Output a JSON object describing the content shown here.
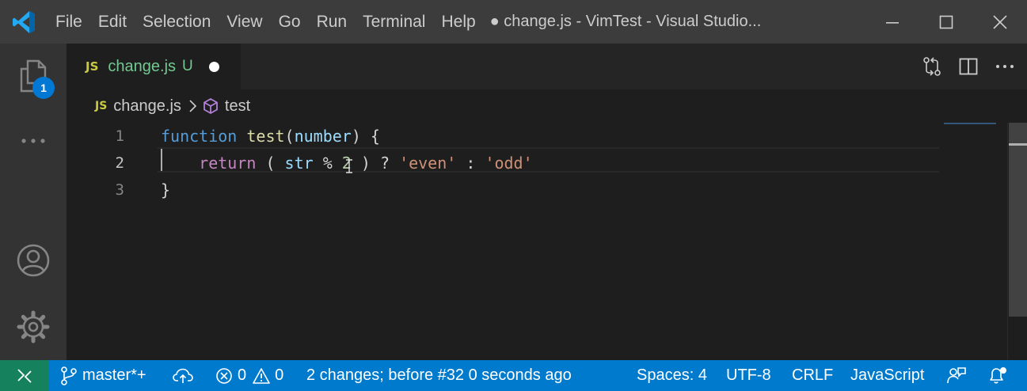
{
  "titlebar": {
    "menu": [
      "File",
      "Edit",
      "Selection",
      "View",
      "Go",
      "Run",
      "Terminal",
      "Help"
    ],
    "title": "● change.js - VimTest - Visual Studio..."
  },
  "activity": {
    "explorer_badge": "1"
  },
  "tab": {
    "language_badge": "JS",
    "filename": "change.js",
    "status": "U"
  },
  "breadcrumb": {
    "language_badge": "JS",
    "file": "change.js",
    "symbol": "test"
  },
  "editor": {
    "line_numbers": [
      "1",
      "2",
      "3"
    ],
    "active_line": 2
  },
  "code": {
    "l1": {
      "kw": "function",
      "fn": "test",
      "p_open": "(",
      "param": "number",
      "rest": ") {"
    },
    "l2": {
      "indent": "    ",
      "kw": "return",
      "a": " ( ",
      "ident": "str",
      "b": " % ",
      "num": "2",
      "c": " ) ? ",
      "s1": "'even'",
      "d": " : ",
      "s2": "'odd'"
    },
    "l3": {
      "text": "}"
    }
  },
  "statusbar": {
    "branch": "master*+",
    "errors": "0",
    "warnings": "0",
    "changes": "2 changes; before #32  0 seconds ago",
    "spaces": "Spaces: 4",
    "encoding": "UTF-8",
    "eol": "CRLF",
    "language": "JavaScript"
  },
  "colors": {
    "statusbar": "#007acc",
    "remote": "#16825d",
    "titlebar": "#3c3c3c",
    "editor_bg": "#1e1e1e",
    "modified_file": "#73c991"
  }
}
